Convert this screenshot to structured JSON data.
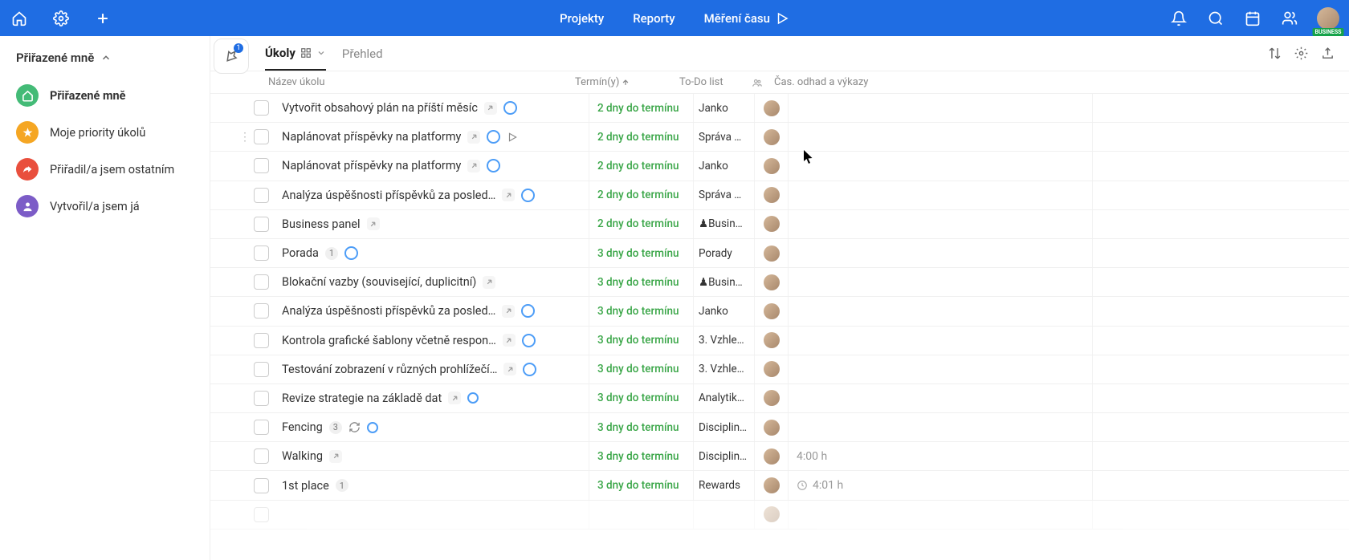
{
  "topbar": {
    "nav": {
      "projekty": "Projekty",
      "reporty": "Reporty",
      "cas": "Měření času"
    },
    "business_badge": "BUSINESS"
  },
  "sidebar": {
    "title": "Přiřazené mně",
    "items": [
      {
        "label": "Přiřazené mně"
      },
      {
        "label": "Moje priority úkolů"
      },
      {
        "label": "Přiřadil/a jsem ostatním"
      },
      {
        "label": "Vytvořil/a jsem já"
      }
    ]
  },
  "pin_badge": "1",
  "tabs": {
    "ukoly": "Úkoly",
    "prehled": "Přehled"
  },
  "columns": {
    "name": "Název úkolu",
    "term": "Termín(y)",
    "todo": "To-Do list",
    "time": "Čas. odhad a výkazy"
  },
  "tasks": [
    {
      "name": "Vytvořit obsahový plán na příští měsíc",
      "ext": true,
      "ring": true,
      "term": "2 dny do termínu",
      "todo": "Janko",
      "time": ""
    },
    {
      "name": "Naplánovat příspěvky na platformy",
      "ext": true,
      "ring": true,
      "play": true,
      "term": "2 dny do termínu",
      "todo": "Správa …",
      "time": "",
      "handle": true
    },
    {
      "name": "Naplánovat příspěvky na platformy",
      "ext": true,
      "ring": true,
      "term": "2 dny do termínu",
      "todo": "Janko",
      "time": ""
    },
    {
      "name": "Analýza úspěšnosti příspěvků za posled…",
      "ext": true,
      "ring": true,
      "term": "2 dny do termínu",
      "todo": "Správa …",
      "time": ""
    },
    {
      "name": "Business panel",
      "ext": true,
      "term": "2 dny do termínu",
      "todo": "♟Busin…",
      "chess": true,
      "time": ""
    },
    {
      "name": "Porada",
      "count": "1",
      "ring": true,
      "term": "3 dny do termínu",
      "todo": "Porady",
      "time": ""
    },
    {
      "name": "Blokační vazby (související, duplicitní)",
      "ext": true,
      "term": "3 dny do termínu",
      "todo": "♟Busin…",
      "chess": true,
      "time": ""
    },
    {
      "name": "Analýza úspěšnosti příspěvků za posled…",
      "ext": true,
      "ring": true,
      "term": "3 dny do termínu",
      "todo": "Janko",
      "time": ""
    },
    {
      "name": "Kontrola grafické šablony včetně respon…",
      "ext": true,
      "ring": true,
      "term": "3 dny do termínu",
      "todo": "3. Vzhle…",
      "time": ""
    },
    {
      "name": "Testování zobrazení v různých prohlížečí…",
      "ext": true,
      "ring": true,
      "term": "3 dny do termínu",
      "todo": "3. Vzhle…",
      "time": ""
    },
    {
      "name": "Revize strategie na základě dat",
      "ext": true,
      "ring": true,
      "ringSmall": true,
      "term": "3 dny do termínu",
      "todo": "Analytik…",
      "time": ""
    },
    {
      "name": "Fencing",
      "count": "3",
      "refresh": true,
      "ring": true,
      "ringSmall": true,
      "term": "3 dny do termínu",
      "todo": "Disciplin…",
      "time": ""
    },
    {
      "name": "Walking",
      "ext": true,
      "term": "3 dny do termínu",
      "todo": "Disciplin…",
      "time": "4:00 h"
    },
    {
      "name": "1st place",
      "count": "1",
      "term": "3 dny do termínu",
      "todo": "Rewards",
      "time": "4:01 h",
      "clock": true
    },
    {
      "name": "",
      "term": "",
      "todo": "",
      "time": "",
      "empty": true
    }
  ]
}
